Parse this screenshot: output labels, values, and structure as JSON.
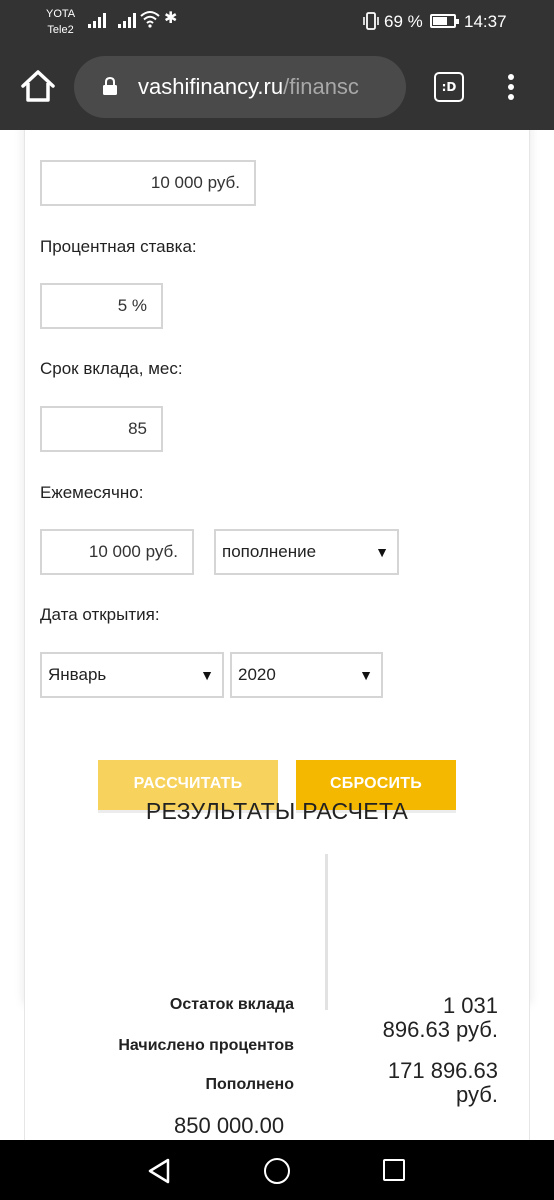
{
  "status_bar": {
    "carrier_1": "YOTA",
    "carrier_2": "Tele2",
    "battery": "69 %",
    "battery_level": 0.69,
    "time": "14:37"
  },
  "browser": {
    "url_host": "vashifinancy.ru",
    "url_path": "/finansc",
    "tab_label": ":D"
  },
  "form": {
    "amount_value": "10 000  руб.",
    "rate_label": "Процентная ставка:",
    "rate_value": "5 %",
    "term_label": "Срок вклада, мес:",
    "term_value": "85",
    "monthly_label": "Ежемесячно:",
    "monthly_value": "10 000  руб.",
    "monthly_type": "пополнение",
    "open_date_label": "Дата открытия:",
    "month": "Январь",
    "year": "2020",
    "calc_button": "РАССЧИТАТЬ",
    "reset_button": "СБРОСИТЬ"
  },
  "results": {
    "title": "РЕЗУЛЬТАТЫ РАСЧЕТА",
    "balance_label": "Остаток вклада",
    "interest_label": "Начислено процентов",
    "replenished_label": "Пополнено",
    "balance_value_line1": "1 031",
    "balance_value_line2": "896.63 руб.",
    "interest_value_line1": "171 896.63",
    "interest_value_line2": "руб.",
    "replenished_value": "850 000.00"
  },
  "colors": {
    "toolbar_bg": "#333333",
    "calc_button": "#f7d25c",
    "reset_button": "#f5b800"
  }
}
